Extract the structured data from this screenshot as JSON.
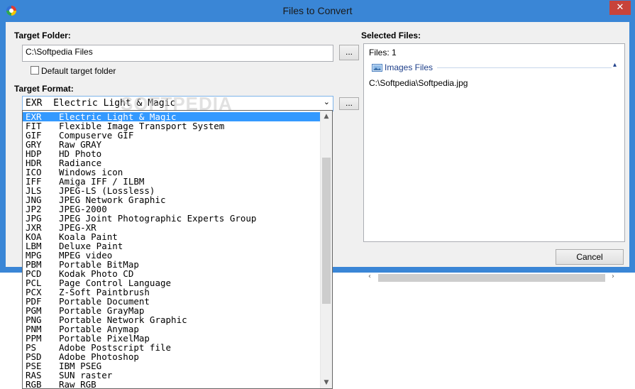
{
  "window": {
    "title": "Files to Convert",
    "close_glyph": "✕",
    "app_icon": "softpedia-converter-icon"
  },
  "watermark": "SOFTPEDIA",
  "target_folder": {
    "label": "Target Folder:",
    "value": "C:\\Softpedia Files",
    "browse_label": "...",
    "default_checkbox_label": "Default target folder",
    "default_checked": false
  },
  "target_format": {
    "label": "Target Format:",
    "selected_code": "EXR",
    "selected_desc": "Electric Light & Magic",
    "browse_label": "..."
  },
  "selected_files": {
    "label": "Selected Files:",
    "count_text": "Files: 1",
    "group_label": "Images Files",
    "group_icon": "image-folder-icon",
    "files": [
      "C:\\Softpedia\\Softpedia.jpg"
    ]
  },
  "buttons": {
    "cancel": "Cancel"
  },
  "colors": {
    "title_bar": "#3a86d6",
    "selection": "#3399ff",
    "close_button": "#c7433a"
  },
  "format_list": [
    {
      "code": "EXR",
      "desc": "Electric Light & Magic",
      "selected": true
    },
    {
      "code": "FIT",
      "desc": "Flexible Image Transport System"
    },
    {
      "code": "GIF",
      "desc": "Compuserve GIF"
    },
    {
      "code": "GRY",
      "desc": "Raw GRAY"
    },
    {
      "code": "HDP",
      "desc": "HD Photo"
    },
    {
      "code": "HDR",
      "desc": "Radiance"
    },
    {
      "code": "ICO",
      "desc": "Windows icon"
    },
    {
      "code": "IFF",
      "desc": "Amiga IFF / ILBM"
    },
    {
      "code": "JLS",
      "desc": "JPEG-LS (Lossless)"
    },
    {
      "code": "JNG",
      "desc": "JPEG Network Graphic"
    },
    {
      "code": "JP2",
      "desc": "JPEG-2000"
    },
    {
      "code": "JPG",
      "desc": "JPEG Joint Photographic Experts Group"
    },
    {
      "code": "JXR",
      "desc": "JPEG-XR"
    },
    {
      "code": "KOA",
      "desc": "Koala Paint"
    },
    {
      "code": "LBM",
      "desc": "Deluxe Paint"
    },
    {
      "code": "MPG",
      "desc": "MPEG video"
    },
    {
      "code": "PBM",
      "desc": "Portable BitMap"
    },
    {
      "code": "PCD",
      "desc": "Kodak Photo CD"
    },
    {
      "code": "PCL",
      "desc": "Page Control Language"
    },
    {
      "code": "PCX",
      "desc": "Z-Soft Paintbrush"
    },
    {
      "code": "PDF",
      "desc": "Portable Document"
    },
    {
      "code": "PGM",
      "desc": "Portable GrayMap"
    },
    {
      "code": "PNG",
      "desc": "Portable Network Graphic"
    },
    {
      "code": "PNM",
      "desc": "Portable Anymap"
    },
    {
      "code": "PPM",
      "desc": "Portable PixelMap"
    },
    {
      "code": "PS",
      "desc": "Adobe Postscript file"
    },
    {
      "code": "PSD",
      "desc": "Adobe Photoshop"
    },
    {
      "code": "PSE",
      "desc": "IBM PSEG"
    },
    {
      "code": "RAS",
      "desc": "SUN raster"
    },
    {
      "code": "RGB",
      "desc": "Raw RGB"
    }
  ]
}
